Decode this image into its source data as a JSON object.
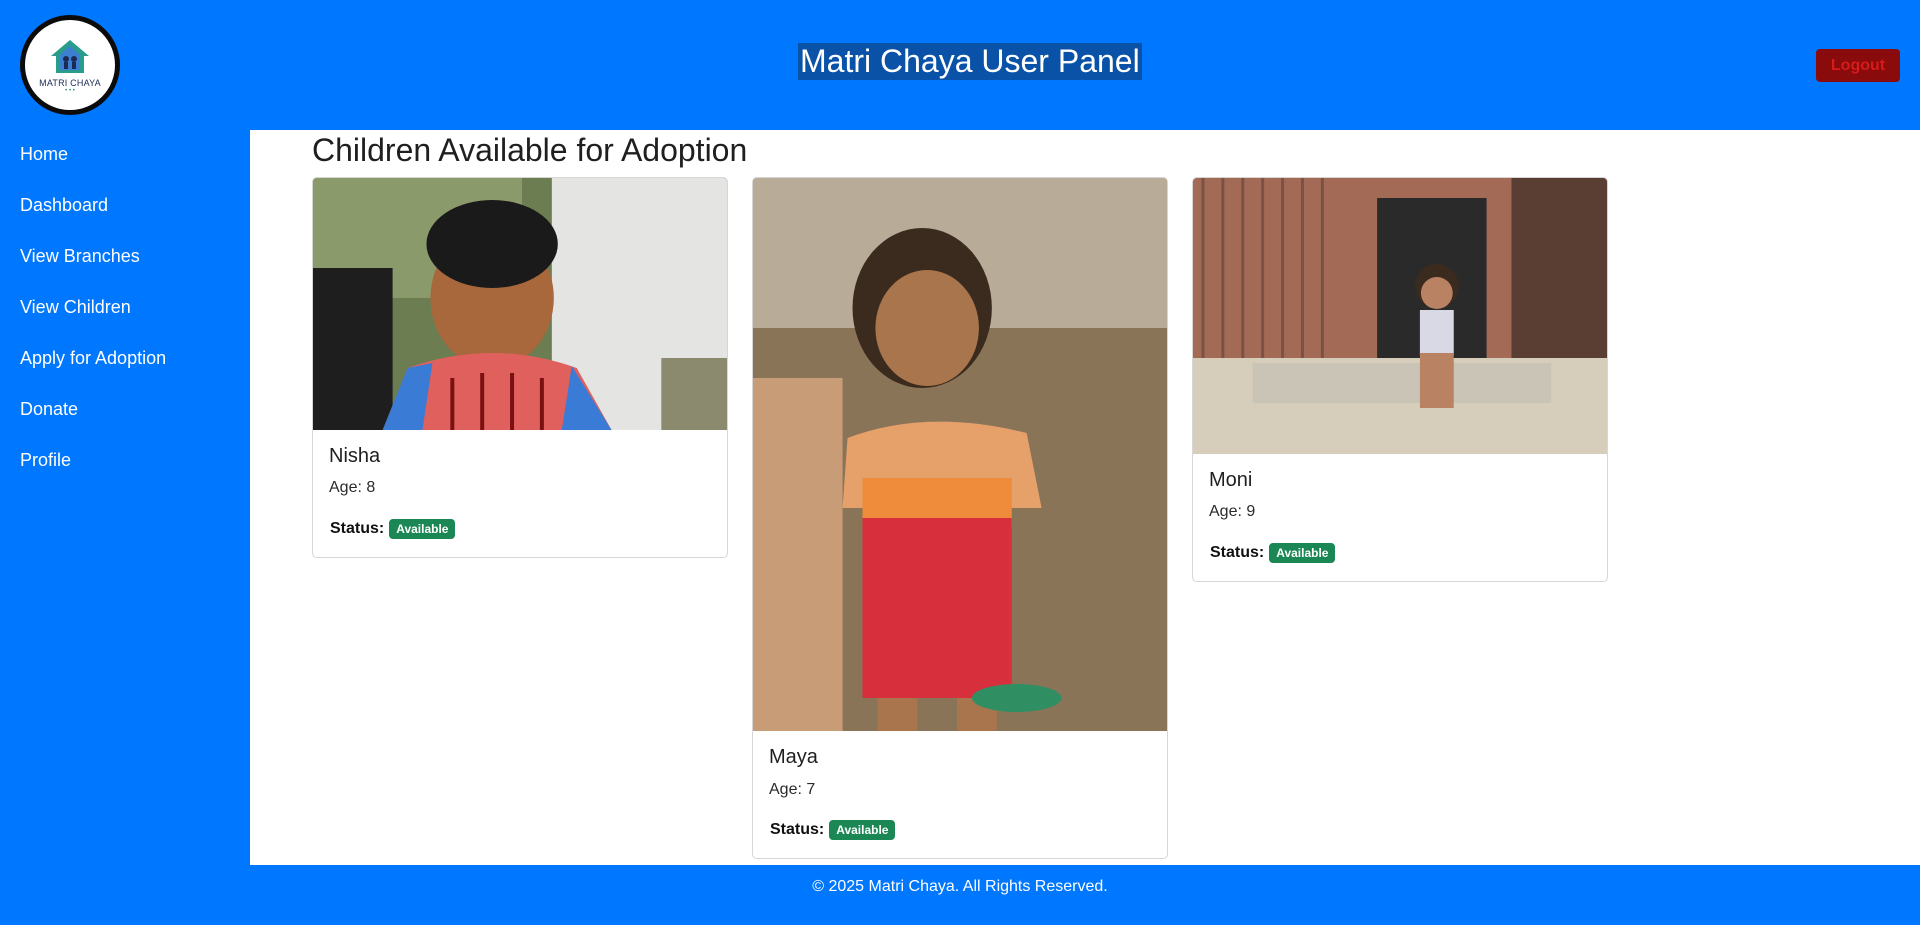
{
  "header": {
    "logo_text": "MATRI CHAYA",
    "title": "Matri Chaya User Panel",
    "logout_label": "Logout"
  },
  "sidebar": {
    "items": [
      {
        "label": "Home"
      },
      {
        "label": "Dashboard"
      },
      {
        "label": "View Branches"
      },
      {
        "label": "View Children"
      },
      {
        "label": "Apply for Adoption"
      },
      {
        "label": "Donate"
      },
      {
        "label": "Profile"
      }
    ]
  },
  "main": {
    "title": "Children Available for Adoption",
    "children": [
      {
        "name": "Nisha",
        "age": "Age: 8",
        "status_label": "Status:",
        "status": "Available",
        "photo_icon": "child-photo"
      },
      {
        "name": "Maya",
        "age": "Age: 7",
        "status_label": "Status:",
        "status": "Available",
        "photo_icon": "child-photo"
      },
      {
        "name": "Moni",
        "age": "Age: 9",
        "status_label": "Status:",
        "status": "Available",
        "photo_icon": "child-photo"
      }
    ]
  },
  "footer": {
    "text": "© 2025 Matri Chaya. All Rights Reserved."
  },
  "colors": {
    "primary": "#0077ff",
    "title_highlight": "#0a52a8",
    "logout_bg": "#8a0b0b",
    "logout_text": "#d71a1a",
    "badge": "#1a8754"
  }
}
